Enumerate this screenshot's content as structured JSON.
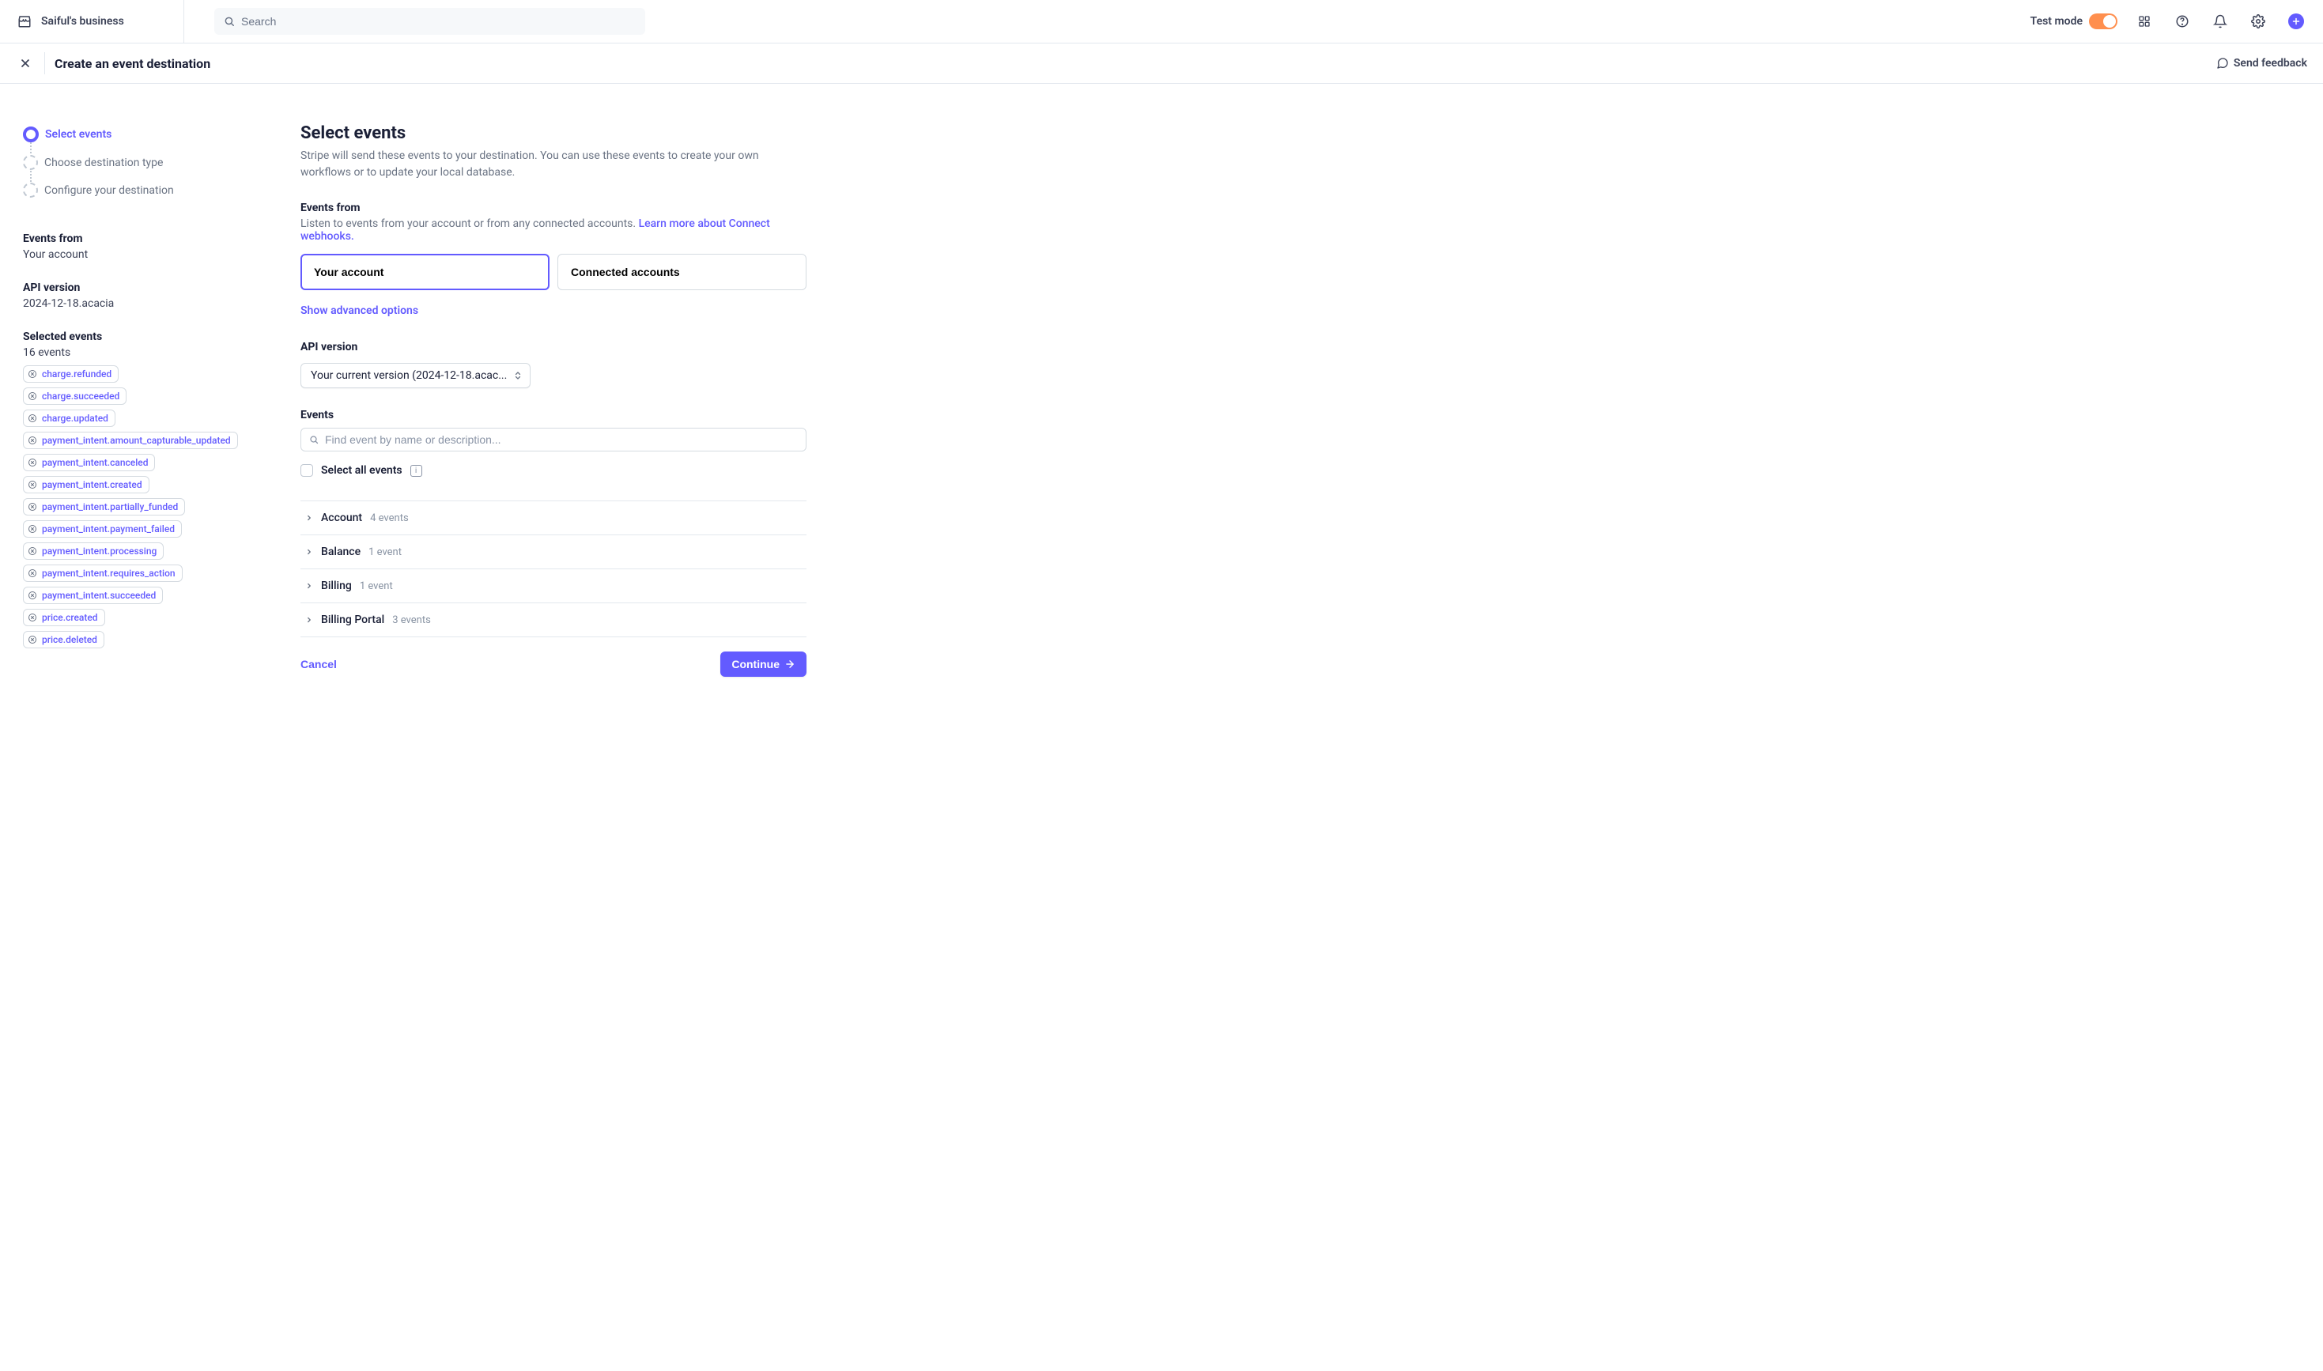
{
  "header": {
    "business_name": "Saiful's business",
    "search_placeholder": "Search",
    "test_mode_label": "Test mode"
  },
  "subheader": {
    "title": "Create an event destination",
    "send_feedback": "Send feedback"
  },
  "stepper": {
    "items": [
      "Select events",
      "Choose destination type",
      "Configure your destination"
    ]
  },
  "summary": {
    "events_from_label": "Events from",
    "events_from_value": "Your account",
    "api_version_label": "API version",
    "api_version_value": "2024-12-18.acacia",
    "selected_events_label": "Selected events",
    "selected_events_value": "16 events",
    "selected_events": [
      "charge.refunded",
      "charge.succeeded",
      "charge.updated",
      "payment_intent.amount_capturable_updated",
      "payment_intent.canceled",
      "payment_intent.created",
      "payment_intent.partially_funded",
      "payment_intent.payment_failed",
      "payment_intent.processing",
      "payment_intent.requires_action",
      "payment_intent.succeeded",
      "price.created",
      "price.deleted"
    ]
  },
  "main": {
    "title": "Select events",
    "description": "Stripe will send these events to your destination. You can use these events to create your own workflows or to update your local database.",
    "events_from_label": "Events from",
    "events_from_hint": "Listen to events from your account or from any connected accounts. ",
    "events_from_link": "Learn more about Connect webhooks.",
    "radio_your_account": "Your account",
    "radio_connected": "Connected accounts",
    "show_advanced": "Show advanced options",
    "api_version_label": "API version",
    "api_version_dropdown": "Your current version (2024-12-18.acac...",
    "events_label": "Events",
    "events_search_placeholder": "Find event by name or description...",
    "select_all_label": "Select all events",
    "categories": [
      {
        "name": "Account",
        "count": "4 events"
      },
      {
        "name": "Balance",
        "count": "1 event"
      },
      {
        "name": "Billing",
        "count": "1 event"
      },
      {
        "name": "Billing Portal",
        "count": "3 events"
      }
    ],
    "cancel": "Cancel",
    "continue": "Continue"
  }
}
